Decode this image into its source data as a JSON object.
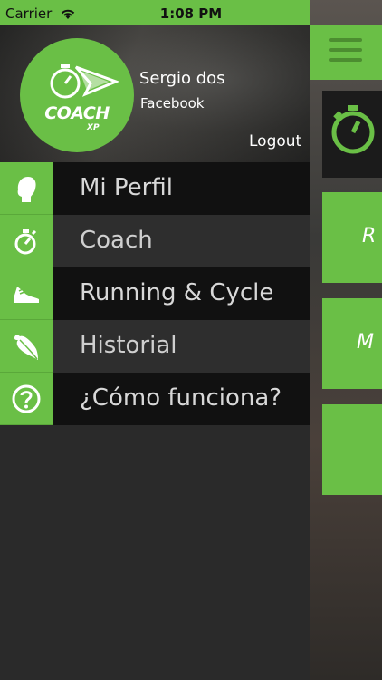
{
  "status_bar": {
    "carrier": "Carrier",
    "time": "1:08 PM"
  },
  "drawer": {
    "user": {
      "name": "Sergio dos",
      "source": "Facebook"
    },
    "logo": {
      "text": "COACH",
      "sub": "XP"
    },
    "logout_label": "Logout",
    "menu": [
      {
        "label": "Mi Perfil",
        "icon": "profile-head-icon",
        "style": "dark"
      },
      {
        "label": "Coach",
        "icon": "stopwatch-icon",
        "style": "light"
      },
      {
        "label": "Running & Cycle",
        "icon": "shoe-icon",
        "style": "dark"
      },
      {
        "label": "Historial",
        "icon": "feather-icon",
        "style": "light"
      },
      {
        "label": "¿Cómo funciona?",
        "icon": "help-circle-icon",
        "style": "dark"
      }
    ]
  },
  "main_peek": {
    "card_1_letter": "R",
    "card_2_letter": "M"
  },
  "colors": {
    "accent": "#6abf46",
    "menu_dark": "#111111",
    "menu_light": "#2e2e2e",
    "background": "#2a2a2a"
  }
}
